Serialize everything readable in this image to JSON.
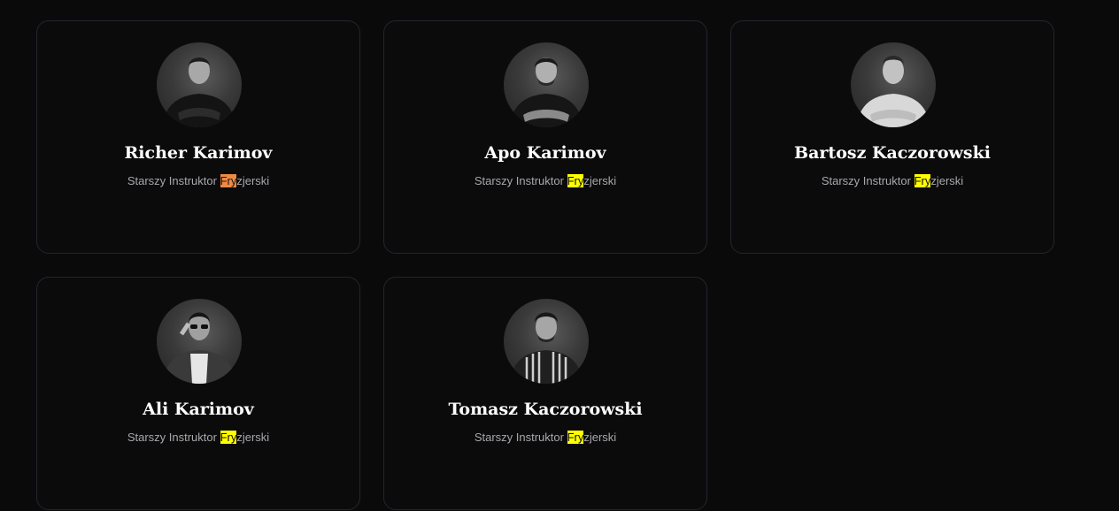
{
  "colors": {
    "background": "#0a0a0b",
    "card_border": "#22262d",
    "highlight_current": "#ef8a44",
    "highlight_match": "#ffff00"
  },
  "find_highlight": {
    "query": "Fry"
  },
  "team": [
    {
      "name": "Richer Karimov",
      "role_before": "Starszy Instruktor ",
      "role_match": "Fry",
      "role_after": "zjerski",
      "highlight": "current"
    },
    {
      "name": "Apo Karimov",
      "role_before": "Starszy Instruktor ",
      "role_match": "Fry",
      "role_after": "zjerski",
      "highlight": "match"
    },
    {
      "name": "Bartosz Kaczorowski",
      "role_before": "Starszy Instruktor ",
      "role_match": "Fry",
      "role_after": "zjerski",
      "highlight": "match"
    },
    {
      "name": "Ali Karimov",
      "role_before": "Starszy Instruktor ",
      "role_match": "Fry",
      "role_after": "zjerski",
      "highlight": "match"
    },
    {
      "name": "Tomasz Kaczorowski",
      "role_before": "Starszy Instruktor ",
      "role_match": "Fry",
      "role_after": "zjerski",
      "highlight": "match"
    }
  ]
}
